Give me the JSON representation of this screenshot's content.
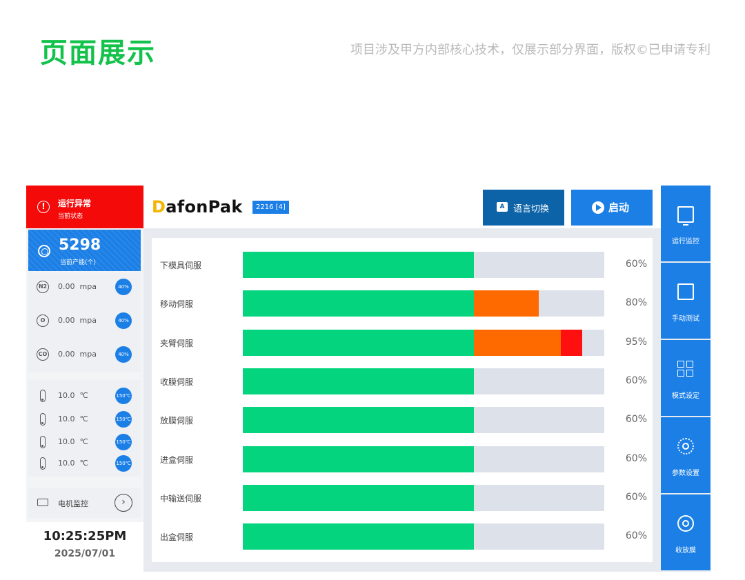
{
  "page": {
    "title": "页面展示",
    "note": "项目涉及甲方内部核心技术，仅展示部分界面，版权©已申请专利"
  },
  "status": {
    "title": "运行异常",
    "subtitle": "当前状态",
    "color": "#f50a0a"
  },
  "production": {
    "value": "5298",
    "label": "当前产能(个)"
  },
  "gas": [
    {
      "icon": "nitrogen-icon",
      "symbol": "N2",
      "value": "0.00",
      "unit": "mpa",
      "badge": "40%"
    },
    {
      "icon": "oxygen-icon",
      "symbol": "O",
      "value": "0.00",
      "unit": "mpa",
      "badge": "40%"
    },
    {
      "icon": "co2-icon",
      "symbol": "CO",
      "value": "0.00",
      "unit": "mpa",
      "badge": "40%"
    }
  ],
  "temperatures": [
    {
      "value": "10.0",
      "unit": "℃",
      "badge": "150℃"
    },
    {
      "value": "10.0",
      "unit": "℃",
      "badge": "150℃"
    },
    {
      "value": "10.0",
      "unit": "℃",
      "badge": "150℃"
    },
    {
      "value": "10.0",
      "unit": "℃",
      "badge": "150℃"
    }
  ],
  "motor": {
    "label": "电机监控",
    "arrow": "›"
  },
  "clock": {
    "time": "10:25:25PM",
    "date": "2025/07/01"
  },
  "header": {
    "logo_d": "D",
    "logo_rest": "afonPak",
    "model": "2216 [4]",
    "lang_icon": "A",
    "lang_label": "语言切换",
    "start_label": "启动"
  },
  "servos": [
    {
      "label": "下模具伺服",
      "green": 0.64,
      "orange": 0,
      "red": 0,
      "percent": "60%"
    },
    {
      "label": "移动伺服",
      "green": 0.64,
      "orange": 0.18,
      "red": 0,
      "percent": "80%"
    },
    {
      "label": "夹臂伺服",
      "green": 0.64,
      "orange": 0.24,
      "red": 0.06,
      "percent": "95%"
    },
    {
      "label": "收膜伺服",
      "green": 0.64,
      "orange": 0,
      "red": 0,
      "percent": "60%"
    },
    {
      "label": "放膜伺服",
      "green": 0.64,
      "orange": 0,
      "red": 0,
      "percent": "60%"
    },
    {
      "label": "进盒伺服",
      "green": 0.64,
      "orange": 0,
      "red": 0,
      "percent": "60%"
    },
    {
      "label": "中输送伺服",
      "green": 0.64,
      "orange": 0,
      "red": 0,
      "percent": "60%"
    },
    {
      "label": "出盒伺服",
      "green": 0.64,
      "orange": 0,
      "red": 0,
      "percent": "60%"
    }
  ],
  "nav": [
    {
      "label": "运行监控",
      "icon": "monitor-icon"
    },
    {
      "label": "手动测试",
      "icon": "hand-icon"
    },
    {
      "label": "模式设定",
      "icon": "grid-icon"
    },
    {
      "label": "参数设置",
      "icon": "gear-icon"
    },
    {
      "label": "收放膜",
      "icon": "film-roll-icon"
    }
  ],
  "colors": {
    "accent": "#1b7fe6",
    "alarm": "#f50a0a",
    "progress_green": "#05d47f",
    "progress_orange": "#ff6a00",
    "progress_red": "#ff1010",
    "title_green": "#13c24a"
  }
}
